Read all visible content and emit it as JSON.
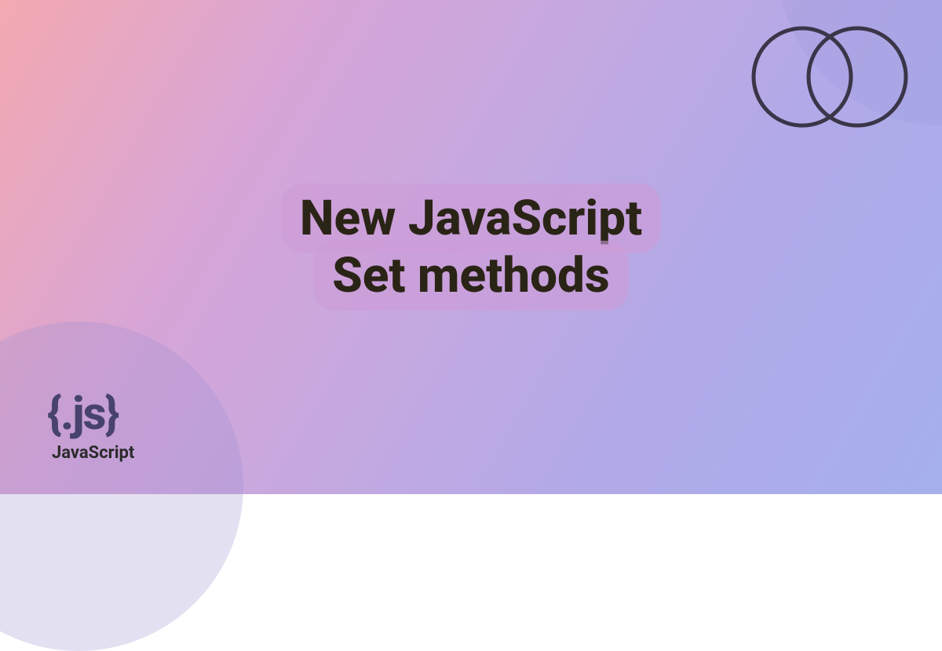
{
  "title": {
    "line1": "New JavaScript",
    "line2": "Set methods"
  },
  "logo": {
    "symbol": "{.js}",
    "label": "JavaScript"
  },
  "colors": {
    "title_text": "#2a2416",
    "logo_text": "#48436e",
    "venn_stroke": "#3a3548"
  }
}
